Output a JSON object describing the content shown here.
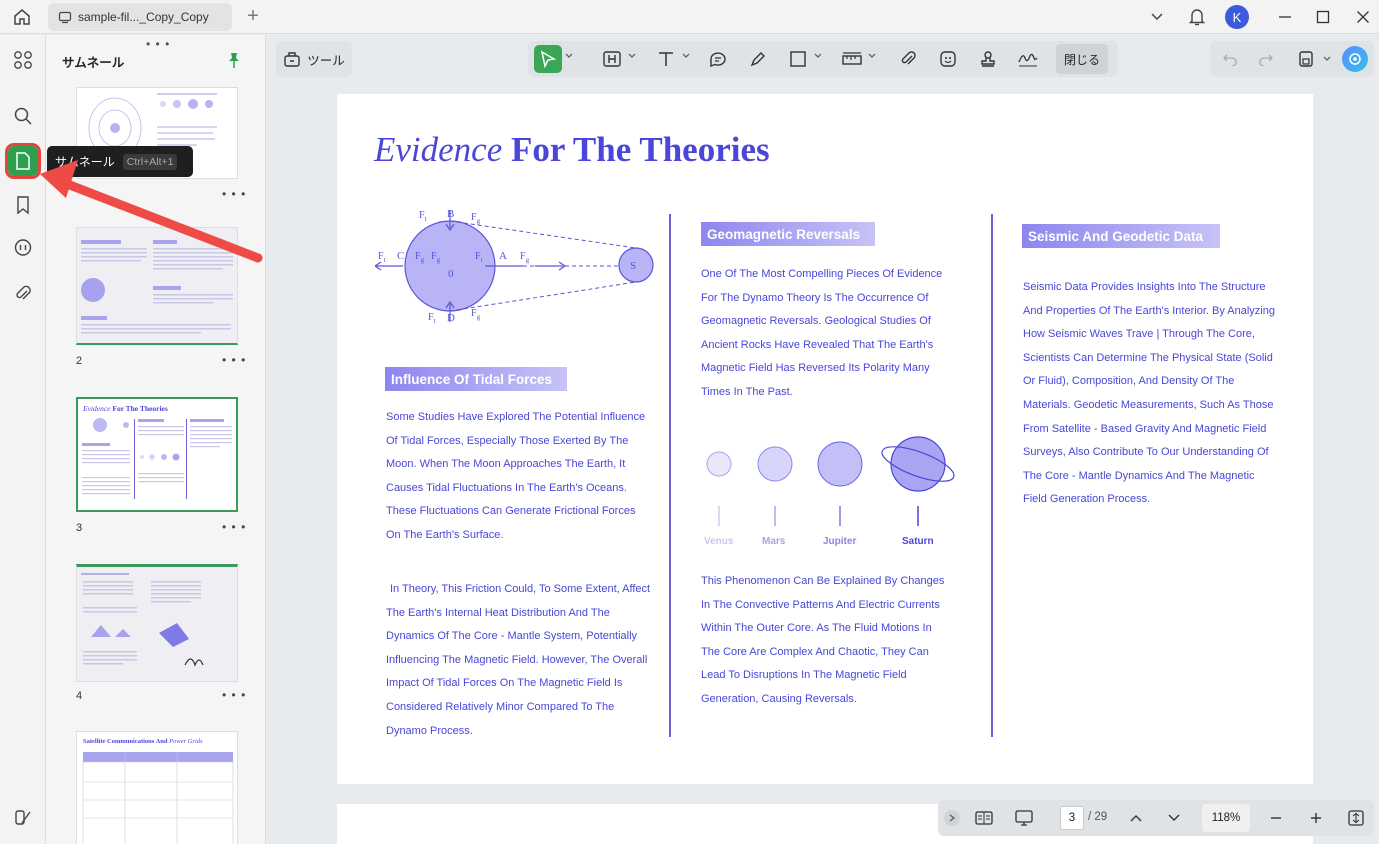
{
  "titlebar": {
    "tab_title": "sample-fil..._Copy_Copy",
    "new_tab_glyph": "+",
    "avatar_initial": "K"
  },
  "sidebar": {
    "panel_title": "サムネール",
    "grip": "• • •",
    "tooltip_label": "サムネール",
    "tooltip_shortcut": "Ctrl+Alt+1",
    "thumbnails": [
      {
        "page": ""
      },
      {
        "page": "2"
      },
      {
        "page": "3"
      },
      {
        "page": "4"
      },
      {
        "page": ""
      }
    ],
    "more_glyph": "• • •"
  },
  "toolbar": {
    "tool_label": "ツール",
    "close_label": "閉じる"
  },
  "document": {
    "title_italic": "Evidence",
    "title_rest": " For The Theories",
    "section1_heading": "Influence Of Tidal Forces",
    "section1_p1": "Some Studies Have Explored The Potential Influence Of Tidal Forces, Especially Those Exerted By The Moon. When The Moon Approaches The Earth, It Causes Tidal Fluctuations In The Earth's Oceans. These Fluctuations Can Generate Frictional Forces On The Earth's Surface.",
    "section1_p2": "In Theory, This Friction Could, To Some Extent, Affect The Earth's Internal Heat Distribution And The Dynamics Of The Core - Mantle System, Potentially Influencing The Magnetic Field. However, The Overall Impact Of Tidal Forces On The Magnetic Field Is Considered Relatively Minor Compared To The Dynamo Process.",
    "section2_heading": "Geomagnetic Reversals",
    "section2_p1": "One Of The Most Compelling Pieces Of Evidence For The Dynamo Theory Is The Occurrence Of Geomagnetic Reversals. Geological Studies Of Ancient Rocks Have Revealed That The Earth's Magnetic Field Has Reversed Its Polarity Many Times In The Past.",
    "section2_p2": "This Phenomenon Can Be Explained By Changes In The Convective Patterns And Electric Currents Within The Outer Core. As The Fluid Motions In The Core Are Complex And Chaotic, They Can Lead To Disruptions In The Magnetic Field Generation, Causing Reversals.",
    "section3_heading": "Seismic And Geodetic Data",
    "section3_p1": "Seismic Data Provides Insights Into The Structure And Properties Of The Earth's Interior. By Analyzing How Seismic Waves Trave | Through The Core, Scientists Can Determine The Physical State (Solid Or Fluid), Composition, And Density Of The Materials. Geodetic Measurements, Such As Those From Satellite - Based Gravity And Magnetic Field Surveys, Also Contribute To Our Understanding Of The Core - Mantle Dynamics And The Magnetic Field Generation Process.",
    "planets": [
      "Venus",
      "Mars",
      "Jupiter",
      "Saturn"
    ],
    "diagram_labels": {
      "b": "B",
      "c": "C",
      "a": "A",
      "d": "D",
      "o": "0",
      "s": "S",
      "ft": "F",
      "fg": "F",
      "sub_t": "t",
      "sub_g": "g"
    },
    "accent_color": "#4a46d9"
  },
  "bottom_nav": {
    "current_page": "3",
    "total_pages": "/ 29",
    "zoom": "118%"
  },
  "thumb_texts": {
    "p3_title_it": "Evidence",
    "p3_title_rest": " For The Theories",
    "p5_title": "Satellite Communications And",
    "p5_title_it": " Power Grids"
  }
}
